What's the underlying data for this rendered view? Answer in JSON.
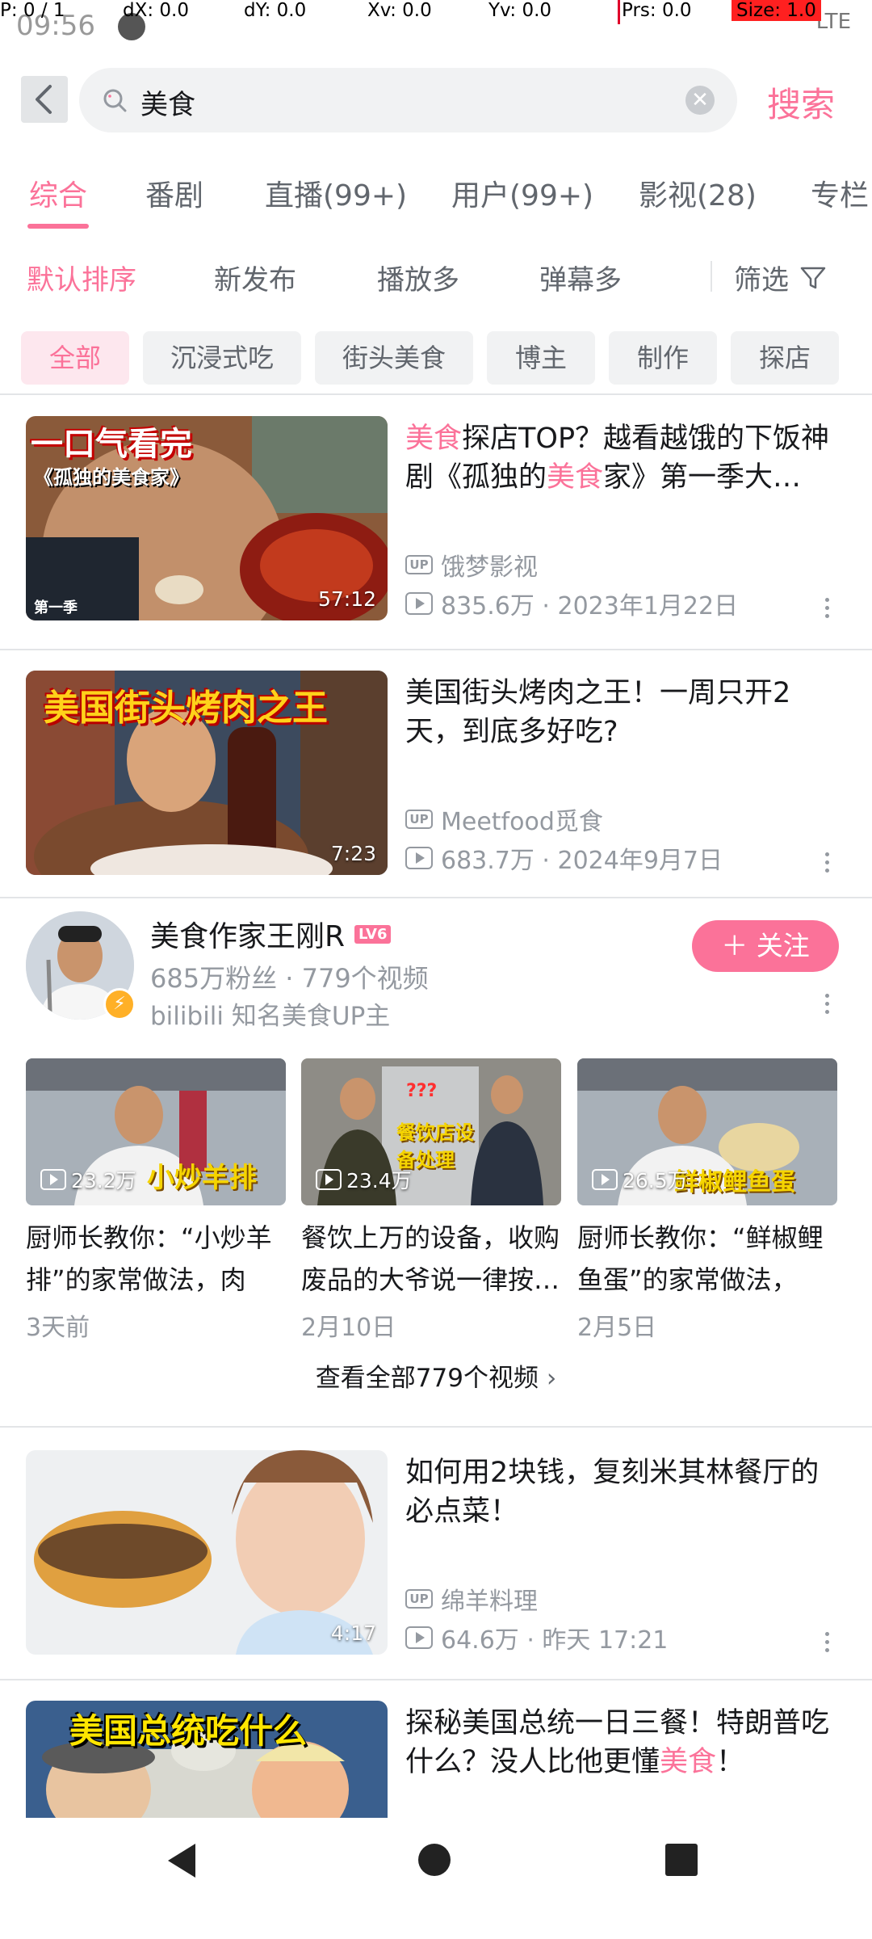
{
  "debug": {
    "p": "P: 0 / 1",
    "dx": "dX: 0.0",
    "dy": "dY: 0.0",
    "xv": "Xv: 0.0",
    "yv": "Yv: 0.0",
    "prs": "Prs: 0.0",
    "size": "Size: 1.0"
  },
  "status": {
    "time": "09:56",
    "signal": "LTE"
  },
  "search": {
    "query": "美食",
    "button": "搜索"
  },
  "tabs": [
    {
      "label": "综合",
      "active": true
    },
    {
      "label": "番剧"
    },
    {
      "label": "直播(99+)"
    },
    {
      "label": "用户(99+)"
    },
    {
      "label": "影视(28)"
    },
    {
      "label": "专栏"
    }
  ],
  "sorts": [
    {
      "label": "默认排序",
      "active": true
    },
    {
      "label": "新发布"
    },
    {
      "label": "播放多"
    },
    {
      "label": "弹幕多"
    }
  ],
  "filter_label": "筛选",
  "chips": [
    "全部",
    "沉浸式吃",
    "街头美食",
    "博主",
    "制作",
    "探店"
  ],
  "videos": [
    {
      "title_parts": [
        {
          "text": "美食",
          "hl": true
        },
        {
          "text": "探店TOP？越看越饿的下饭神剧《孤独的",
          "hl": false
        },
        {
          "text": "美食",
          "hl": true
        },
        {
          "text": "家》第一季大…",
          "hl": false
        }
      ],
      "thumb_caption": "一口气看完",
      "thumb_sub": "《孤独的美食家》",
      "thumb_tag": "第一季",
      "duration": "57:12",
      "uploader": "饿梦影视",
      "stats": "835.6万 · 2023年1月22日"
    },
    {
      "title_parts": [
        {
          "text": "美国街头烤肉之王！一周只开2天，到底多好吃?",
          "hl": false
        }
      ],
      "thumb_caption": "美国街头烤肉之王",
      "duration": "7:23",
      "uploader": "Meetfood觅食",
      "stats": "683.7万 · 2024年9月7日"
    },
    {
      "title_parts": [
        {
          "text": "如何用2块钱，复刻米其林餐厅的必点菜！",
          "hl": false
        }
      ],
      "duration": "4:17",
      "uploader": "绵羊料理",
      "stats": "64.6万 · 昨天 17:21"
    },
    {
      "title_parts": [
        {
          "text": "探秘美国总统一日三餐！特朗普吃什么？没人比他更懂",
          "hl": false
        },
        {
          "text": "美食",
          "hl": true
        },
        {
          "text": "！",
          "hl": false
        }
      ],
      "thumb_caption": "美国总统吃什么"
    }
  ],
  "user": {
    "name": "美食作家王刚R",
    "level": "LV6",
    "fans": "685万粉丝 · 779个视频",
    "desc": "bilibili 知名美食UP主",
    "follow": "＋ 关注",
    "videos": [
      {
        "views": "23.2万",
        "overlay": "小炒羊排",
        "title": "厨师长教你：“小炒羊排”的家常做法，肉香…",
        "date": "3天前"
      },
      {
        "views": "23.4万",
        "overlay": "餐饮店设备处理",
        "title": "餐饮上万的设备，收购废品的大爷说一律按…",
        "date": "2月10日"
      },
      {
        "views": "26.5万",
        "overlay": "鲜椒鲤鱼蛋",
        "title": "厨师长教你：“鲜椒鲤鱼蛋”的家常做法，鲜…",
        "date": "2月5日"
      }
    ],
    "see_all": "查看全部779个视频"
  },
  "colors": {
    "accent": "#fb7299",
    "secondary_text": "#9499a0",
    "divider": "#e3e5e7"
  }
}
